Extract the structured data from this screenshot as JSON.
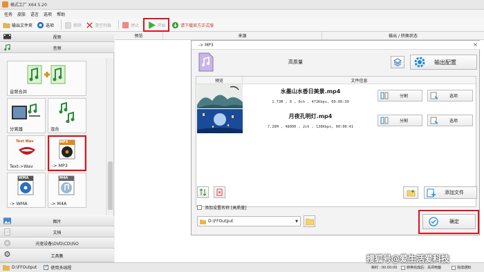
{
  "window": {
    "title": "格式工厂 X64 5.20"
  },
  "menu": [
    "任务",
    "皮肤",
    "语言",
    "选项",
    "帮助"
  ],
  "toolbar": {
    "output_folder": "输出文件夹",
    "options": "选项",
    "remove": "移除",
    "clear_list": "清空列表",
    "stop": "停止",
    "start": "开始",
    "download_full": "请下载官方正式版"
  },
  "main_header": {
    "preview": "预览",
    "source": "来源",
    "output_status": "输出 / 转换状态"
  },
  "sidebar": {
    "categories_top": [
      {
        "label": "视频",
        "icon": "video-icon"
      },
      {
        "label": "音频",
        "icon": "music-icon"
      }
    ],
    "tiles": [
      {
        "label": "音频合并"
      },
      {
        "label": "分离器"
      },
      {
        "label": "混合"
      },
      {
        "label": "Text->Wav"
      },
      {
        "label": "-> MP3"
      },
      {
        "label": "-> WMA"
      },
      {
        "label": "-> M4A"
      }
    ],
    "tile_logo_text": {
      "text_wav": "Text Wav",
      "mp3": "MP3",
      "wma": "WMA",
      "m4a": "M4A"
    },
    "categories_bottom": [
      {
        "label": "图片",
        "icon": "image-icon"
      },
      {
        "label": "文档",
        "icon": "document-icon"
      },
      {
        "label": "光驱设备\\DVD\\CD\\ISO",
        "icon": "disc-icon"
      },
      {
        "label": "工具集",
        "icon": "tools-icon"
      }
    ]
  },
  "dialog": {
    "title": "-> MP3",
    "close": "×",
    "quality": "高质量",
    "output_config": "输出配置",
    "list_header": {
      "preview": "预览",
      "file_info": "文件信息"
    },
    "files": [
      {
        "name": "水墨山水香日美景.mp4",
        "info": "1.73M , 0 , 0ch , 472Kbps, 00:00:30",
        "split": "分割",
        "options": "选项"
      },
      {
        "name": "月夜孔明灯.mp4",
        "info": "7.26M , 48000 , 2ch , 136Kbps, 00:00:41",
        "split": "分割",
        "options": "选项"
      }
    ],
    "add_file": "添加文件",
    "add_setting_name": "添加设置名称 [高质量]",
    "output_path": "D:\\FFOutput",
    "ok": "确定"
  },
  "statusbar": {
    "path": "D:\\FFOutput",
    "multithread": "使用多线程",
    "elapsed": "耗时 : 00:00:00",
    "after_convert": "转换完成后：关闭电脑",
    "notify": "完成通知"
  },
  "watermark": "搜狐号@爱生活爱科技",
  "colors": {
    "accent_red": "#e0111a",
    "start_green": "#3cae3c",
    "selected_blue": "#1f78d1"
  }
}
